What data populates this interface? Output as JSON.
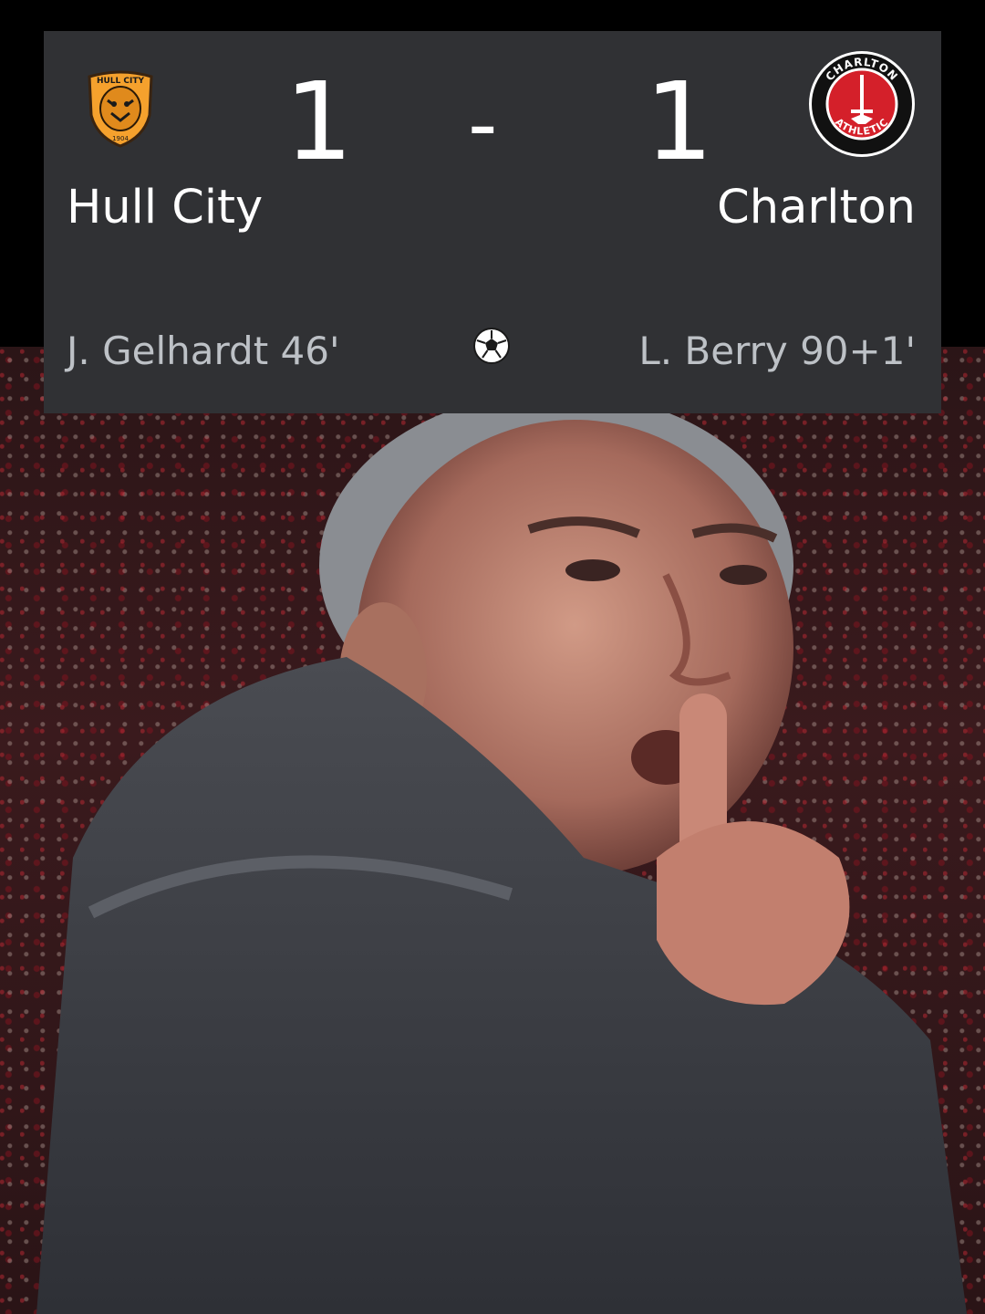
{
  "match": {
    "home": {
      "name": "Hull City",
      "score": "1",
      "crest_icon": "hull-city-crest-icon",
      "crest_text": "HULL CITY",
      "crest_year": "1904",
      "scorer": "J. Gelhardt 46'"
    },
    "separator": "-",
    "away": {
      "name": "Charlton",
      "score": "1",
      "crest_icon": "charlton-crest-icon",
      "crest_text_top": "CHARLTON",
      "crest_text_bottom": "ATHLETIC",
      "scorer": "L. Berry 90+1'"
    },
    "goal_icon": "soccer-ball-icon"
  },
  "colors": {
    "card_bg": "#303134",
    "text_primary": "#ffffff",
    "text_secondary": "#bdc1c6",
    "hull_orange": "#f5a12d",
    "charlton_red": "#d4202a"
  }
}
